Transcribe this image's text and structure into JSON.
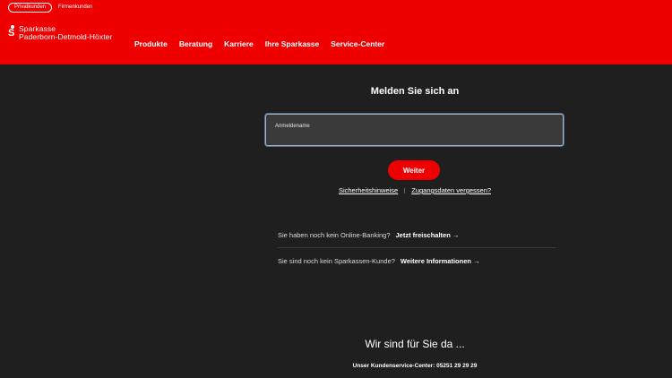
{
  "segments": {
    "privat": "Privatkunden",
    "firmen": "Firmenkunden"
  },
  "brand": {
    "line1": "Sparkasse",
    "line2": "Paderborn-Detmold-Höxter",
    "icon_char": "S"
  },
  "nav": [
    "Produkte",
    "Beratung",
    "Karriere",
    "Ihre Sparkasse",
    "Service-Center"
  ],
  "login": {
    "title": "Melden Sie sich an",
    "username_label": "Anmeldename",
    "submit": "Weiter",
    "security_link": "Sicherheitshinweise",
    "forgot_link": "Zugangsdaten vergessen?"
  },
  "info": {
    "no_banking": "Sie haben noch kein Online-Banking?",
    "unlock": "Jetzt freischalten",
    "no_customer": "Sie sind noch kein Sparkassen-Kunde?",
    "more": "Weitere Informationen"
  },
  "help": {
    "title": "Wir sind für Sie da ...",
    "phone": "Unser Kundenservice-Center: 05251 29 29 29"
  },
  "colors": {
    "brand_red": "#ee0000",
    "background": "#1f1f1f"
  }
}
